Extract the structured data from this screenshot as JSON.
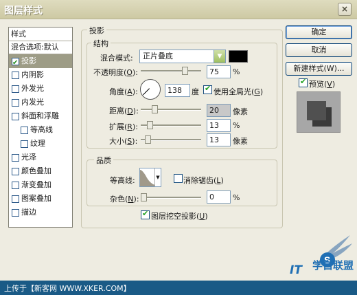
{
  "window": {
    "title": "图层样式",
    "close_glyph": "×"
  },
  "sidebar": {
    "header": "样式",
    "blend_default": "混合选项:默认",
    "items": [
      {
        "label": "投影",
        "checked": true,
        "selected": true,
        "indent": false
      },
      {
        "label": "内阴影",
        "checked": false,
        "selected": false,
        "indent": false
      },
      {
        "label": "外发光",
        "checked": false,
        "selected": false,
        "indent": false
      },
      {
        "label": "内发光",
        "checked": false,
        "selected": false,
        "indent": false
      },
      {
        "label": "斜面和浮雕",
        "checked": false,
        "selected": false,
        "indent": false
      },
      {
        "label": "等高线",
        "checked": false,
        "selected": false,
        "indent": true
      },
      {
        "label": "纹理",
        "checked": false,
        "selected": false,
        "indent": true
      },
      {
        "label": "光泽",
        "checked": false,
        "selected": false,
        "indent": false
      },
      {
        "label": "颜色叠加",
        "checked": false,
        "selected": false,
        "indent": false
      },
      {
        "label": "渐变叠加",
        "checked": false,
        "selected": false,
        "indent": false
      },
      {
        "label": "图案叠加",
        "checked": false,
        "selected": false,
        "indent": false
      },
      {
        "label": "描边",
        "checked": false,
        "selected": false,
        "indent": false
      }
    ]
  },
  "shadow": {
    "section_title": "投影",
    "structure": {
      "title": "结构",
      "blend_mode_label": "混合模式:",
      "blend_mode_value": "正片叠底",
      "opacity_label": "不透明度(",
      "opacity_key": "O",
      "opacity_suffix": "):",
      "opacity_value": "75",
      "opacity_level": 75,
      "percent": "%",
      "angle_label": "角度(",
      "angle_key": "A",
      "angle_suffix": "):",
      "angle_value": "138",
      "angle_unit": "度",
      "global_light_label": "使用全局光(",
      "global_light_key": "G",
      "global_light_suffix": ")",
      "global_light_checked": true,
      "distance_label": "距离(",
      "distance_key": "D",
      "distance_suffix": "):",
      "distance_value": "20",
      "distance_unit": "像素",
      "spread_label": "扩展(",
      "spread_key": "R",
      "spread_suffix": "):",
      "spread_value": "13",
      "size_label": "大小(",
      "size_key": "S",
      "size_suffix": "):",
      "size_value": "13",
      "size_unit": "像素"
    },
    "quality": {
      "title": "品质",
      "contour_label": "等高线:",
      "antialias_label": "消除锯齿(",
      "antialias_key": "L",
      "antialias_suffix": ")",
      "noise_label": "杂色(",
      "noise_key": "N",
      "noise_suffix": "):",
      "noise_value": "0",
      "percent": "%"
    },
    "knockout_label": "图层挖空投影(",
    "knockout_key": "U",
    "knockout_suffix": ")"
  },
  "buttons": {
    "ok": "确定",
    "cancel": "取消",
    "new_style": "新建样式(W)...",
    "preview_label": "预览(",
    "preview_key": "V",
    "preview_suffix": ")"
  },
  "footer": {
    "text": "上传于【新客网 WWW.XKER.COM】"
  },
  "watermark": {
    "brand": "学自联盟",
    "it": "IT"
  },
  "colors": {
    "blend_color": "#000000",
    "selected_bg": "#9d9c86",
    "footer_bg": "#1a5a86"
  }
}
